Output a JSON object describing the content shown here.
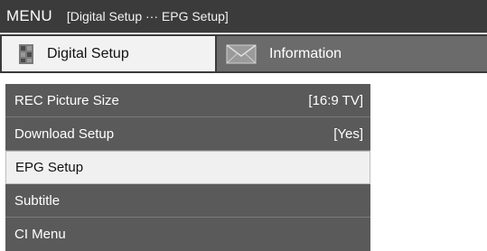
{
  "header": {
    "title": "MENU",
    "breadcrumb": "[Digital Setup ··· EPG Setup]"
  },
  "tabs": [
    {
      "label": "Digital Setup",
      "icon": "puzzle-icon",
      "active": true
    },
    {
      "label": "Information",
      "icon": "envelope-icon",
      "active": false
    }
  ],
  "menu": {
    "items": [
      {
        "label": "REC Picture Size",
        "value": "[16:9 TV]",
        "selected": false
      },
      {
        "label": "Download Setup",
        "value": "[Yes]",
        "selected": false
      },
      {
        "label": "EPG Setup",
        "value": "",
        "selected": true
      },
      {
        "label": "Subtitle",
        "value": "",
        "selected": false
      },
      {
        "label": "CI Menu",
        "value": "",
        "selected": false
      }
    ]
  },
  "colors": {
    "header_bg": "#3b3b3b",
    "menu_bg": "#5a5a5a",
    "selected_bg": "#f0f0f0",
    "active_tab_bg": "#f2f2f2",
    "inactive_tab_bg": "#6b6b6b"
  }
}
